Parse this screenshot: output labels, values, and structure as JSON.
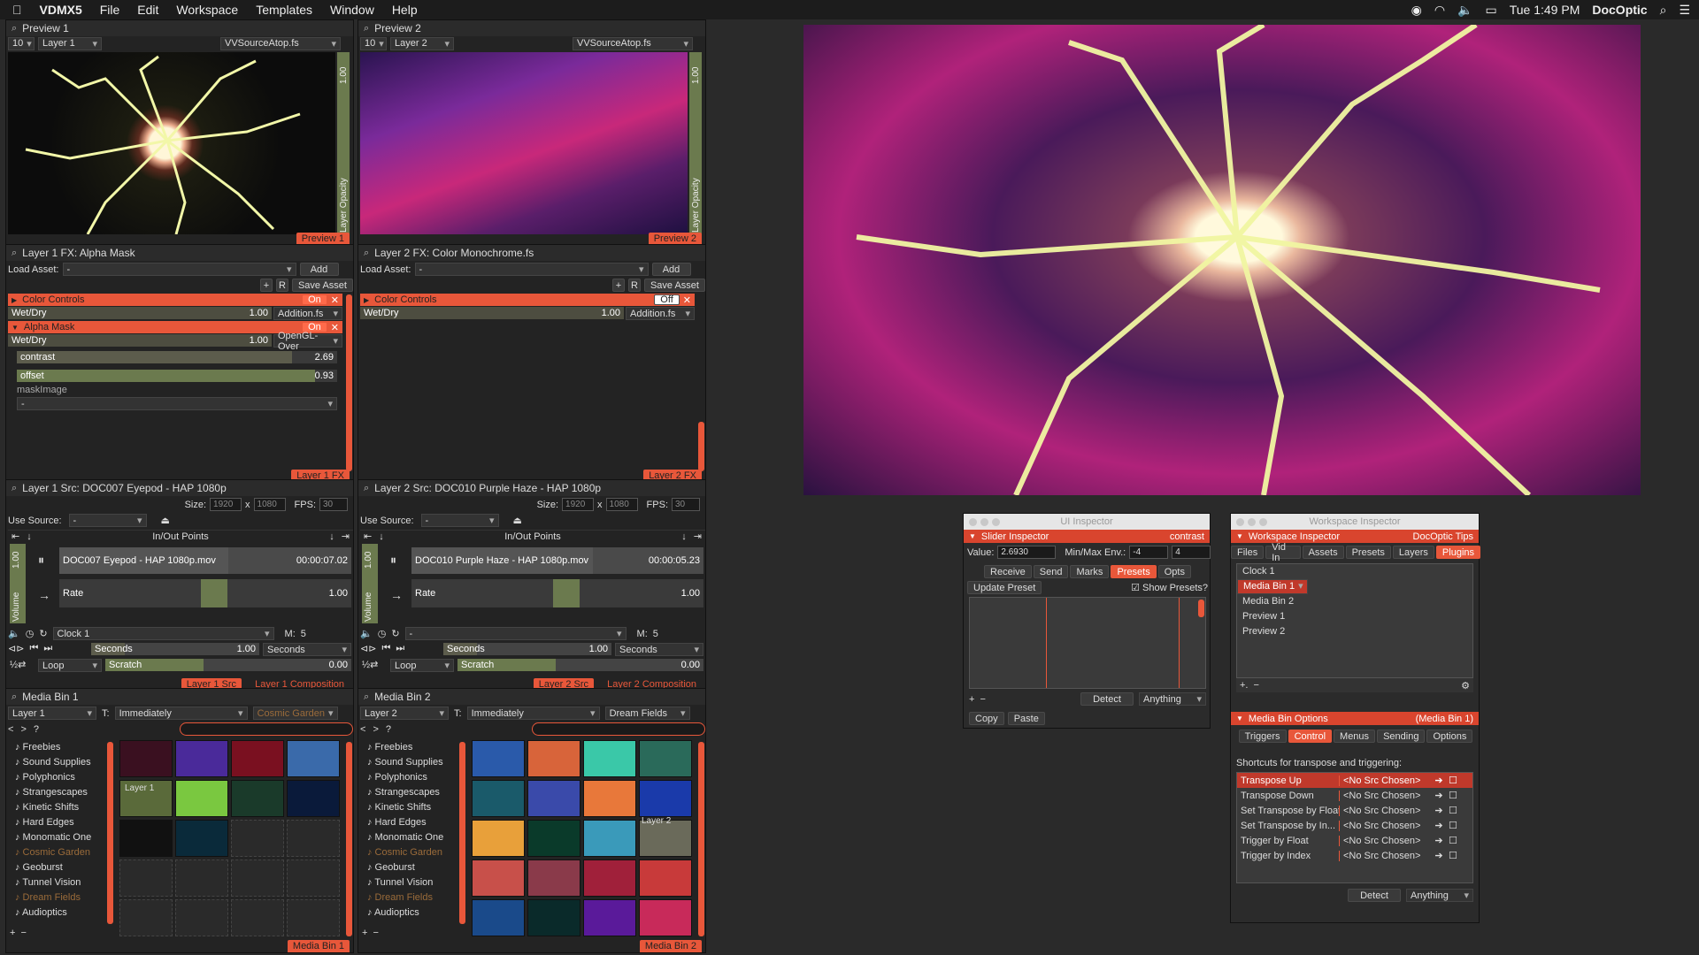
{
  "menubar": {
    "app": "VDMX5",
    "items": [
      "File",
      "Edit",
      "Workspace",
      "Templates",
      "Window",
      "Help"
    ],
    "clock": "Tue 1:49 PM",
    "user": "DocOptic"
  },
  "preview1": {
    "title": "Preview 1",
    "num": "10",
    "layer": "Layer 1",
    "shader": "VVSourceAtop.fs",
    "opacity_value": "1.00",
    "opacity_label": "Layer Opacity",
    "tag": "Preview 1"
  },
  "preview2": {
    "title": "Preview 2",
    "num": "10",
    "layer": "Layer 2",
    "shader": "VVSourceAtop.fs",
    "opacity_value": "1.00",
    "opacity_label": "Layer Opacity",
    "tag": "Preview 2"
  },
  "fx1": {
    "title": "Layer 1 FX: Alpha Mask",
    "load_asset": "Load Asset:",
    "asset_value": "-",
    "add": "Add",
    "r": "R",
    "save": "Save Asset",
    "color_controls": "Color Controls",
    "cc_state": "On",
    "wetdry": "Wet/Dry",
    "wetdry_val": "1.00",
    "blend": "Addition.fs",
    "alpha_mask": "Alpha Mask",
    "am_state": "On",
    "wetdry2": "Wet/Dry",
    "wetdry2_val": "1.00",
    "blend2": "OpenGL- Over",
    "contrast": "contrast",
    "contrast_val": "2.69",
    "offset": "offset",
    "offset_val": "0.93",
    "maskimage": "maskImage",
    "mask_value": "-",
    "tag": "Layer 1 FX"
  },
  "fx2": {
    "title": "Layer 2 FX: Color Monochrome.fs",
    "load_asset": "Load Asset:",
    "asset_value": "-",
    "add": "Add",
    "r": "R",
    "save": "Save Asset",
    "color_controls": "Color Controls",
    "cc_state": "Off",
    "wetdry": "Wet/Dry",
    "wetdry_val": "1.00",
    "blend": "Addition.fs",
    "tag": "Layer 2 FX"
  },
  "src1": {
    "title": "Layer 1 Src: DOC007 Eyepod - HAP 1080p",
    "size": "Size:",
    "w": "1920",
    "x": "x",
    "h": "1080",
    "fps": "FPS:",
    "fps_val": "30",
    "use_source": "Use Source:",
    "use_val": "-",
    "inout": "In/Out Points",
    "file": "DOC007 Eyepod - HAP 1080p.mov",
    "time": "00:00:07.02",
    "vol": "1.00",
    "volume": "Volume",
    "rate": "Rate",
    "rate_val": "1.00",
    "clock": "Clock 1",
    "m": "M:",
    "m_val": "5",
    "seconds": "Seconds",
    "sec_val": "1.00",
    "seconds2": "Seconds",
    "loop": "Loop",
    "scratch": "Scratch",
    "scratch_val": "0.00",
    "tag_src": "Layer 1 Src",
    "tag_comp": "Layer 1 Composition"
  },
  "src2": {
    "title": "Layer 2 Src: DOC010 Purple Haze - HAP 1080p",
    "size": "Size:",
    "w": "1920",
    "x": "x",
    "h": "1080",
    "fps": "FPS:",
    "fps_val": "30",
    "use_source": "Use Source:",
    "use_val": "-",
    "inout": "In/Out Points",
    "file": "DOC010 Purple Haze - HAP 1080p.mov",
    "time": "00:00:05.23",
    "vol": "1.00",
    "volume": "Volume",
    "rate": "Rate",
    "rate_val": "1.00",
    "clock": "-",
    "m": "M:",
    "m_val": "5",
    "seconds": "Seconds",
    "sec_val": "1.00",
    "seconds2": "Seconds",
    "loop": "Loop",
    "scratch": "Scratch",
    "scratch_val": "0.00",
    "tag_src": "Layer 2 Src",
    "tag_comp": "Layer 2 Composition"
  },
  "bin1": {
    "title": "Media Bin 1",
    "layer": "Layer 1",
    "t": "T:",
    "trigger": "Immediately",
    "page": "Cosmic Garden",
    "layer_label": "Layer 1",
    "tag": "Media Bin 1",
    "items": [
      {
        "label": "Freebies",
        "dim": false
      },
      {
        "label": "Sound Supplies",
        "dim": false
      },
      {
        "label": "Polyphonics",
        "dim": false
      },
      {
        "label": "Strangescapes",
        "dim": false
      },
      {
        "label": "Kinetic Shifts",
        "dim": false
      },
      {
        "label": "Hard Edges",
        "dim": false
      },
      {
        "label": "Monomatic One",
        "dim": false
      },
      {
        "label": "Cosmic Garden",
        "dim": true
      },
      {
        "label": "Geoburst",
        "dim": false
      },
      {
        "label": "Tunnel Vision",
        "dim": false
      },
      {
        "label": "Dream Fields",
        "dim": true
      },
      {
        "label": "Audioptics",
        "dim": false
      }
    ]
  },
  "bin2": {
    "title": "Media Bin 2",
    "layer": "Layer 2",
    "t": "T:",
    "trigger": "Immediately",
    "page": "Dream Fields",
    "layer_label": "Layer 2",
    "tag": "Media Bin 2",
    "items": [
      {
        "label": "Freebies",
        "dim": false
      },
      {
        "label": "Sound Supplies",
        "dim": false
      },
      {
        "label": "Polyphonics",
        "dim": false
      },
      {
        "label": "Strangescapes",
        "dim": false
      },
      {
        "label": "Kinetic Shifts",
        "dim": false
      },
      {
        "label": "Hard Edges",
        "dim": false
      },
      {
        "label": "Monomatic One",
        "dim": false
      },
      {
        "label": "Cosmic Garden",
        "dim": true
      },
      {
        "label": "Geoburst",
        "dim": false
      },
      {
        "label": "Tunnel Vision",
        "dim": false
      },
      {
        "label": "Dream Fields",
        "dim": true
      },
      {
        "label": "Audioptics",
        "dim": false
      }
    ]
  },
  "ui_inspector": {
    "title": "UI Inspector",
    "header": "Slider Inspector",
    "header_right": "contrast",
    "value_label": "Value:",
    "value": "2.6930",
    "minmax_label": "Min/Max Env.:",
    "min": "-4",
    "max": "4",
    "tabs": [
      "Receive",
      "Send",
      "Marks",
      "Presets",
      "Opts"
    ],
    "active_tab": "Presets",
    "update_preset": "Update Preset",
    "show_presets": "Show Presets?",
    "detect": "Detect",
    "anything": "Anything",
    "copy": "Copy",
    "paste": "Paste"
  },
  "ws_inspector": {
    "title": "Workspace Inspector",
    "header": "Workspace Inspector",
    "header_right": "DocOptic Tips",
    "tabs": [
      "Files",
      "Vid In",
      "Assets",
      "Presets",
      "Layers",
      "Plugins"
    ],
    "active_tab": "Plugins",
    "plugins": [
      "Clock 1",
      "Media Bin 1",
      "Media Bin 2",
      "Preview 1",
      "Preview 2"
    ],
    "selected": "Media Bin 1",
    "options_header": "Media Bin Options",
    "options_right": "(Media Bin 1)",
    "opt_tabs": [
      "Triggers",
      "Control",
      "Menus",
      "Sending",
      "Options"
    ],
    "opt_active": "Control",
    "shortcuts_label": "Shortcuts for transpose and triggering:",
    "shortcuts": [
      {
        "name": "Transpose Up",
        "src": "<No Src Chosen>"
      },
      {
        "name": "Transpose Down",
        "src": "<No Src Chosen>"
      },
      {
        "name": "Set Transpose by Float",
        "src": "<No Src Chosen>"
      },
      {
        "name": "Set Transpose by In...",
        "src": "<No Src Chosen>"
      },
      {
        "name": "Trigger by Float",
        "src": "<No Src Chosen>"
      },
      {
        "name": "Trigger by Index",
        "src": "<No Src Chosen>"
      }
    ],
    "detect": "Detect",
    "anything": "Anything"
  },
  "colors": {
    "accent": "#e8573a",
    "header_red": "#d9452e",
    "panel": "#232323",
    "bg": "#2a2a2a"
  }
}
